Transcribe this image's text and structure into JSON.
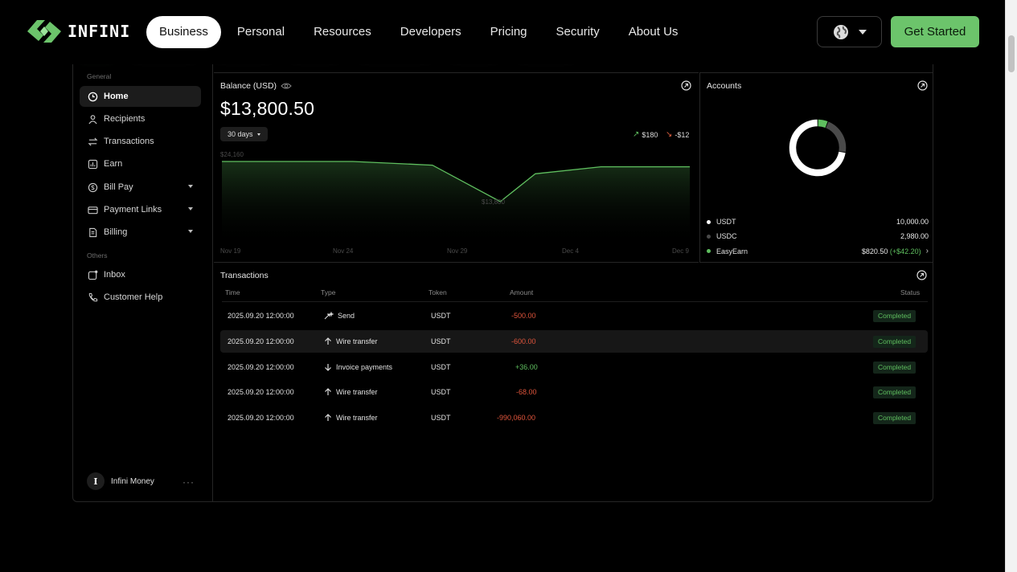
{
  "nav": {
    "logo_text": "INFINI",
    "items": [
      "Business",
      "Personal",
      "Resources",
      "Developers",
      "Pricing",
      "Security",
      "About Us"
    ],
    "cta": "Get Started"
  },
  "sidebar": {
    "group_general": "General",
    "items": [
      {
        "label": "Home",
        "icon": "home-icon"
      },
      {
        "label": "Recipients",
        "icon": "user-icon"
      },
      {
        "label": "Transactions",
        "icon": "swap-icon"
      },
      {
        "label": "Earn",
        "icon": "chart-icon"
      },
      {
        "label": "Bill Pay",
        "icon": "bill-icon"
      },
      {
        "label": "Payment Links",
        "icon": "card-icon"
      },
      {
        "label": "Billing",
        "icon": "document-icon"
      }
    ],
    "group_others": "Others",
    "others": [
      {
        "label": "Inbox",
        "icon": "inbox-icon"
      },
      {
        "label": "Customer Help",
        "icon": "phone-icon"
      }
    ],
    "user": {
      "initial": "I",
      "name": "Infini Money",
      "more": "···"
    }
  },
  "balance": {
    "title": "Balance (USD)",
    "amount": "$13,800.50",
    "range": "30 days",
    "up": "$180",
    "down": "-$12",
    "chart_data": {
      "type": "area",
      "x_ticks": [
        "Nov 19",
        "Nov 24",
        "Nov 29",
        "Dec 4",
        "Dec 9"
      ],
      "max_label": "$24,160",
      "min_label": "$13,800",
      "points": [
        {
          "x": 0,
          "y": 24160
        },
        {
          "x": 0.28,
          "y": 24160
        },
        {
          "x": 0.45,
          "y": 23200
        },
        {
          "x": 0.595,
          "y": 13800
        },
        {
          "x": 0.67,
          "y": 21000
        },
        {
          "x": 0.81,
          "y": 22800
        },
        {
          "x": 1.0,
          "y": 22800
        }
      ],
      "color": "#5fbf5f"
    }
  },
  "accounts": {
    "title": "Accounts",
    "items": [
      {
        "name": "USDT",
        "value": "10,000.00",
        "color": "#ffffff"
      },
      {
        "name": "USDC",
        "value": "2,980.00",
        "color": "#4a4a4a"
      },
      {
        "name": "EasyEarn",
        "value": "$820.50",
        "gain": "(+$42.20)",
        "color": "#5fbf5f"
      }
    ],
    "chart_data": {
      "type": "pie",
      "labels": [
        "USDT",
        "USDC",
        "EasyEarn"
      ],
      "values": [
        10000,
        2980,
        820.5
      ]
    }
  },
  "transactions": {
    "title": "Transactions",
    "headers": {
      "time": "Time",
      "type": "Type",
      "token": "Token",
      "amount": "Amount",
      "status": "Status"
    },
    "rows": [
      {
        "time": "2025.09.20 12:00:00",
        "type": "Send",
        "icon": "send-icon",
        "token": "USDT",
        "amount": "-500.00",
        "sign": "neg",
        "status": "Completed"
      },
      {
        "time": "2025.09.20 12:00:00",
        "type": "Wire transfer",
        "icon": "arrow-up-icon",
        "token": "USDT",
        "amount": "-600.00",
        "sign": "neg",
        "status": "Completed"
      },
      {
        "time": "2025.09.20 12:00:00",
        "type": "Invoice payments",
        "icon": "arrow-down-icon",
        "token": "USDT",
        "amount": "+36.00",
        "sign": "pos",
        "status": "Completed"
      },
      {
        "time": "2025.09.20 12:00:00",
        "type": "Wire transfer",
        "icon": "arrow-up-icon",
        "token": "USDT",
        "amount": "-68.00",
        "sign": "neg",
        "status": "Completed"
      },
      {
        "time": "2025.09.20 12:00:00",
        "type": "Wire transfer",
        "icon": "arrow-up-icon",
        "token": "USDT",
        "amount": "-990,060.00",
        "sign": "neg",
        "status": "Completed"
      }
    ]
  },
  "colors": {
    "accent": "#6cc46b",
    "negative": "#e0553c",
    "panel_border": "#262626"
  }
}
